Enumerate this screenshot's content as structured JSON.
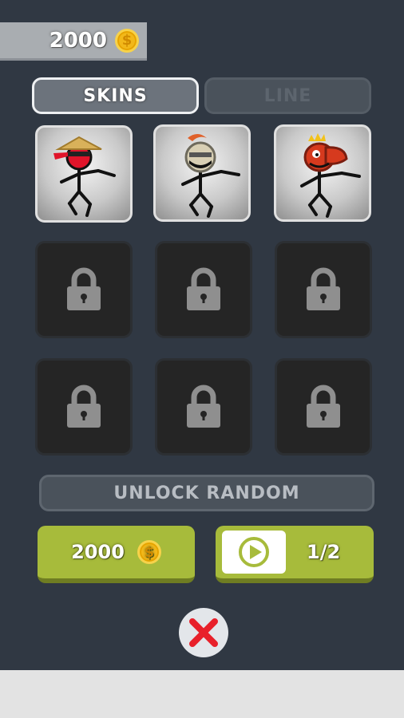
{
  "header": {
    "coins": "2000"
  },
  "tabs": {
    "skins": "SKINS",
    "line": "LINE",
    "selected": "SKINS"
  },
  "skins": [
    {
      "name": "straw-hat-ninja",
      "state": "unlocked"
    },
    {
      "name": "knight-helmet",
      "state": "unlocked"
    },
    {
      "name": "dragon-mask",
      "state": "unlocked"
    },
    {
      "state": "locked"
    },
    {
      "state": "locked"
    },
    {
      "state": "locked"
    },
    {
      "state": "locked"
    },
    {
      "state": "locked"
    },
    {
      "state": "locked"
    }
  ],
  "unlock": {
    "title": "UNLOCK RANDOM",
    "price": "2000",
    "video_progress": "1/2"
  },
  "icons": {
    "coin": "coin-icon",
    "lock": "lock-icon",
    "play": "play-icon",
    "close": "close-icon"
  },
  "colors": {
    "background": "#303843",
    "accent_green": "#a7bb3b",
    "close_red": "#e8202a",
    "coin_gold": "#f2b81a"
  }
}
